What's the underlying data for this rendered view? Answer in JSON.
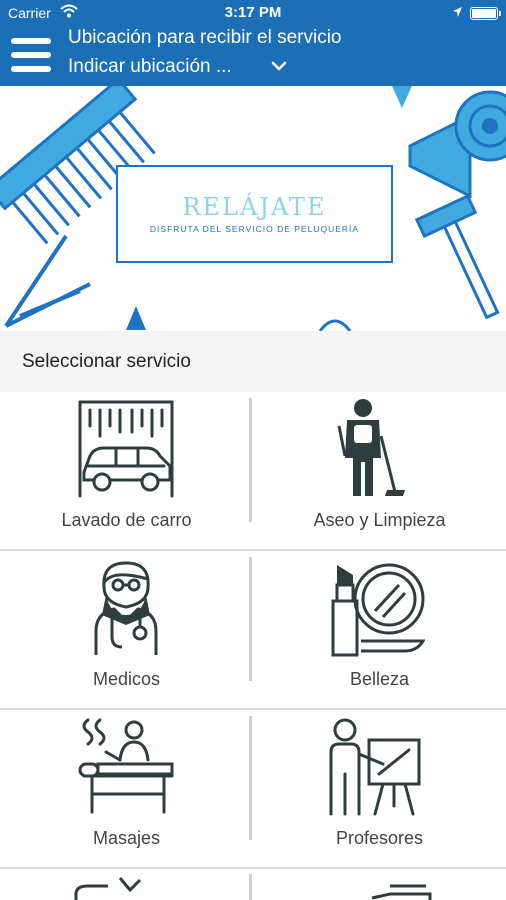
{
  "status_bar": {
    "carrier": "Carrier",
    "time": "3:17 PM"
  },
  "header": {
    "title": "Ubicación para recibir el servicio",
    "location_value": "Indicar ubicación ..."
  },
  "banner": {
    "brand": "RELÁJATE",
    "tagline": "DISFRUTA DEL SERVICIO DE PELUQUERÍA"
  },
  "services": {
    "title": "Seleccionar servicio",
    "items": [
      {
        "label": "Lavado de carro",
        "icon": "car-wash-icon"
      },
      {
        "label": "Aseo y Limpieza",
        "icon": "cleaning-icon"
      },
      {
        "label": "Medicos",
        "icon": "doctor-icon"
      },
      {
        "label": "Belleza",
        "icon": "beauty-icon"
      },
      {
        "label": "Masajes",
        "icon": "massage-icon"
      },
      {
        "label": "Profesores",
        "icon": "teacher-icon"
      }
    ]
  },
  "colors": {
    "nav_bar": "#1a6fb7",
    "icon_dark": "#2f3d3f",
    "banner_blue": "#1f73c2",
    "banner_light": "#3fa9e0"
  }
}
